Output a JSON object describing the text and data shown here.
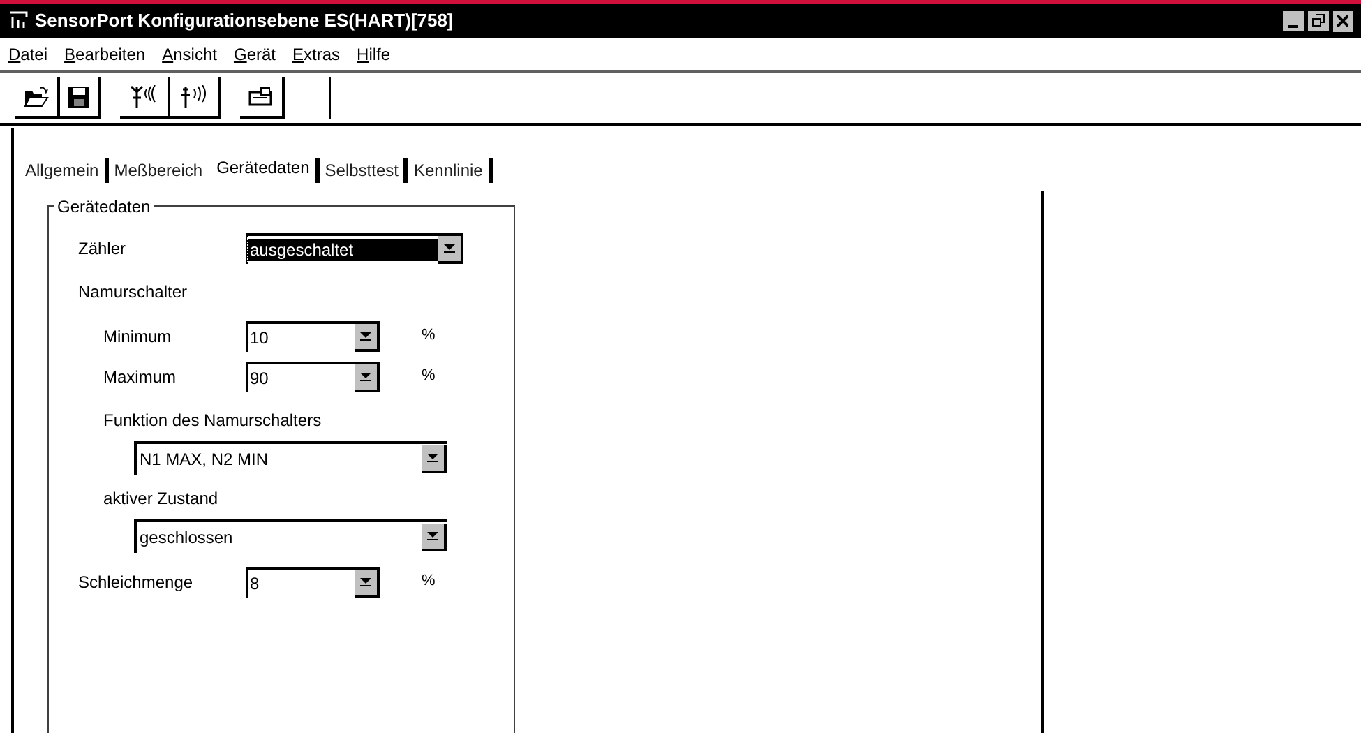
{
  "window": {
    "title": "SensorPort Konfigurationsebene ES(HART)[758]"
  },
  "menu": [
    "Datei",
    "Bearbeiten",
    "Ansicht",
    "Gerät",
    "Extras",
    "Hilfe"
  ],
  "toolbar": [
    [
      {
        "kind": "open"
      },
      {
        "kind": "save"
      }
    ],
    [
      {
        "kind": "antenna"
      },
      {
        "kind": "signal"
      }
    ],
    [
      {
        "kind": "window"
      }
    ]
  ],
  "tabs": [
    {
      "label": "Allgemein",
      "selected": false
    },
    {
      "label": "Meßbereich",
      "selected": false
    },
    {
      "label": "Gerätedaten",
      "selected": true
    },
    {
      "label": "Selbsttest",
      "selected": false
    },
    {
      "label": "Kennlinie",
      "selected": false
    }
  ],
  "group": {
    "title": "Gerätedaten",
    "rows": [
      {
        "kind": "combo",
        "label": "Zähler",
        "value": "ausgeschaltet",
        "focused": true
      },
      {
        "kind": "section",
        "label": "Namurschalter",
        "children": [
          {
            "kind": "combo",
            "label": "Minimum",
            "value": "10",
            "unit": "%",
            "focused": false
          },
          {
            "kind": "combo",
            "label": "Maximum",
            "value": "90",
            "unit": "%",
            "focused": false
          },
          {
            "kind": "wide",
            "label": "Funktion des Namurschalters",
            "value": "N1 MAX, N2 MIN"
          },
          {
            "kind": "wide",
            "label": "aktiver Zustand",
            "value": "geschlossen"
          }
        ]
      },
      {
        "kind": "combo",
        "label": "Schleichmenge",
        "value": "8",
        "unit": "%",
        "focused": false
      }
    ]
  }
}
